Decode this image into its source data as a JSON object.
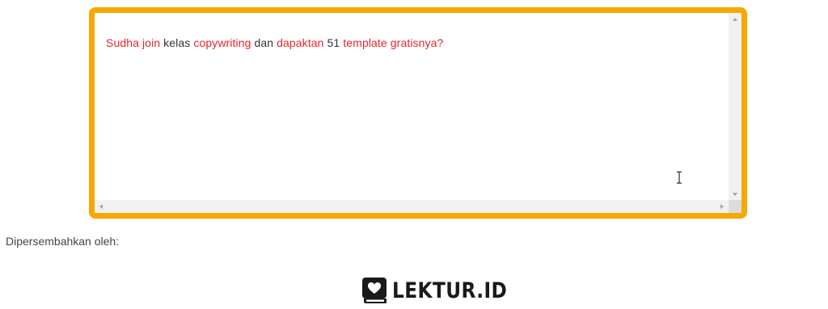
{
  "editor": {
    "text_segments": [
      {
        "text": "Sudha join",
        "highlight": true
      },
      {
        "text": " kelas ",
        "highlight": false
      },
      {
        "text": "copywriting",
        "highlight": true
      },
      {
        "text": " dan ",
        "highlight": false
      },
      {
        "text": "dapaktan",
        "highlight": true
      },
      {
        "text": " 51 ",
        "highlight": false
      },
      {
        "text": "template gratisnya?",
        "highlight": true
      }
    ],
    "border_color": "#f7a800",
    "highlight_color": "#e8232a"
  },
  "footer": {
    "presented_by": "Dipersembahkan oleh:",
    "logo_text": "LEKTUR.ID"
  },
  "icons": {
    "cursor": "text-cursor-icon",
    "logo": "book-heart-icon"
  }
}
